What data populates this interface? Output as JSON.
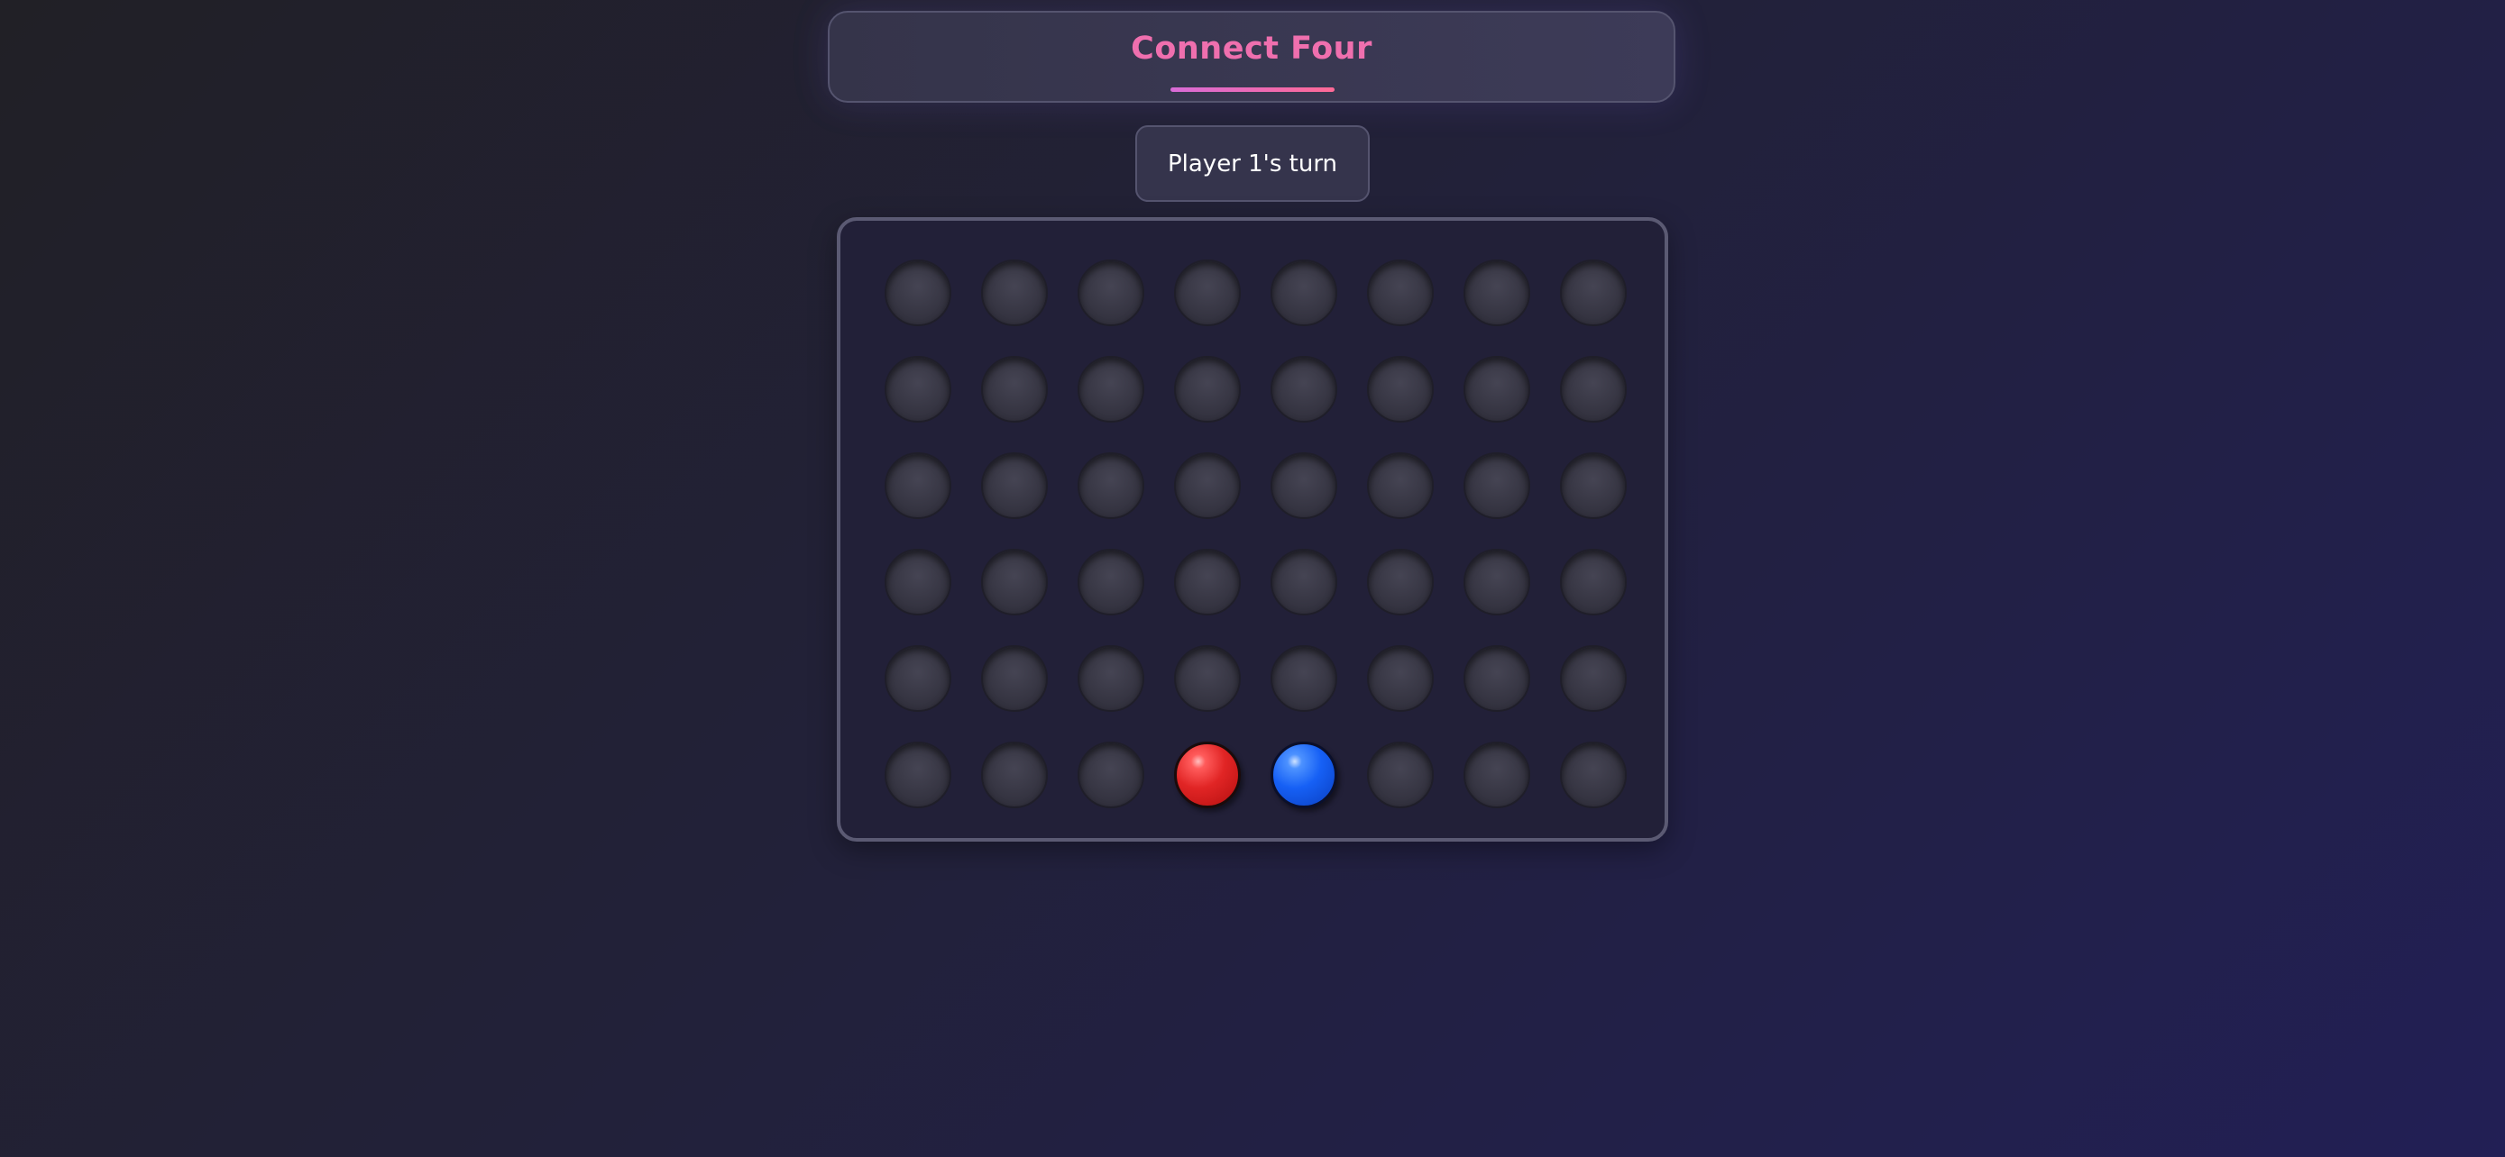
{
  "game": {
    "title": "Connect Four",
    "status": "Player 1's turn",
    "rows": 6,
    "columns": 8,
    "board": [
      [
        "empty",
        "empty",
        "empty",
        "empty",
        "empty",
        "empty",
        "empty",
        "empty"
      ],
      [
        "empty",
        "empty",
        "empty",
        "empty",
        "empty",
        "empty",
        "empty",
        "empty"
      ],
      [
        "empty",
        "empty",
        "empty",
        "empty",
        "empty",
        "empty",
        "empty",
        "empty"
      ],
      [
        "empty",
        "empty",
        "empty",
        "empty",
        "empty",
        "empty",
        "empty",
        "empty"
      ],
      [
        "empty",
        "empty",
        "empty",
        "empty",
        "empty",
        "empty",
        "empty",
        "empty"
      ],
      [
        "empty",
        "empty",
        "empty",
        "red",
        "blue",
        "empty",
        "empty",
        "empty"
      ]
    ]
  },
  "colors": {
    "title": "#ef6fae",
    "player1_disc": "#e12525",
    "player2_disc": "#1660f5",
    "empty_slot": "#33323f"
  }
}
